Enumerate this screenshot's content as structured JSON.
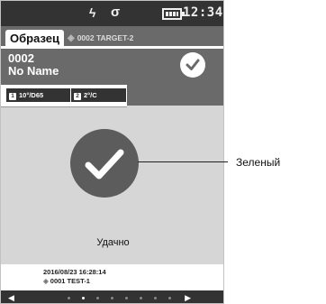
{
  "status_bar": {
    "bolt_glyph": "ϟ",
    "usb_glyph": "σ",
    "time": "12:34"
  },
  "tabs": {
    "active_label": "Образец",
    "target_label": "0002 TARGET-2"
  },
  "sample": {
    "number": "0002",
    "name": "No Name"
  },
  "conditions": [
    {
      "num": "1",
      "text": "10°/D65"
    },
    {
      "num": "2",
      "text": "2°/C"
    }
  ],
  "result": {
    "text": "Удачно",
    "callout": "Зеленый"
  },
  "footer": {
    "datetime": "2016/08/23 16:28:14",
    "target": "0001 TEST-1"
  },
  "pager": {
    "page_count": 8,
    "current_page": 2
  },
  "colors": {
    "dark_bar": "#333333",
    "panel_gray": "#6a6a6a",
    "screen_bg": "#d6d6d6",
    "check_circle": "#5c5c5c"
  }
}
